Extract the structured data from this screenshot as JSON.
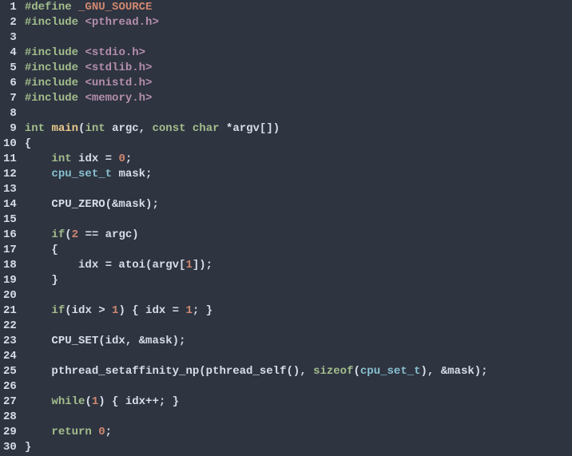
{
  "code": {
    "line_count": 30,
    "lines": [
      [
        {
          "cls": "tok-pp",
          "t": "#define "
        },
        {
          "cls": "tok-ppid",
          "t": "_GNU_SOURCE"
        }
      ],
      [
        {
          "cls": "tok-pp",
          "t": "#include "
        },
        {
          "cls": "tok-inc",
          "t": "<pthread.h>"
        }
      ],
      [],
      [
        {
          "cls": "tok-pp",
          "t": "#include "
        },
        {
          "cls": "tok-inc",
          "t": "<stdio.h>"
        }
      ],
      [
        {
          "cls": "tok-pp",
          "t": "#include "
        },
        {
          "cls": "tok-inc",
          "t": "<stdlib.h>"
        }
      ],
      [
        {
          "cls": "tok-pp",
          "t": "#include "
        },
        {
          "cls": "tok-inc",
          "t": "<unistd.h>"
        }
      ],
      [
        {
          "cls": "tok-pp",
          "t": "#include "
        },
        {
          "cls": "tok-inc",
          "t": "<memory.h>"
        }
      ],
      [],
      [
        {
          "cls": "tok-kw",
          "t": "int"
        },
        {
          "cls": "tok-ident",
          "t": " "
        },
        {
          "cls": "tok-fn",
          "t": "main"
        },
        {
          "cls": "tok-punc",
          "t": "("
        },
        {
          "cls": "tok-kw",
          "t": "int"
        },
        {
          "cls": "tok-ident",
          "t": " argc, "
        },
        {
          "cls": "tok-kw",
          "t": "const"
        },
        {
          "cls": "tok-ident",
          "t": " "
        },
        {
          "cls": "tok-kw",
          "t": "char"
        },
        {
          "cls": "tok-ident",
          "t": " *argv[])"
        }
      ],
      [
        {
          "cls": "tok-punc",
          "t": "{"
        }
      ],
      [
        {
          "cls": "tok-ident",
          "t": "    "
        },
        {
          "cls": "tok-kw",
          "t": "int"
        },
        {
          "cls": "tok-ident",
          "t": " idx = "
        },
        {
          "cls": "tok-num",
          "t": "0"
        },
        {
          "cls": "tok-punc",
          "t": ";"
        }
      ],
      [
        {
          "cls": "tok-ident",
          "t": "    "
        },
        {
          "cls": "tok-type",
          "t": "cpu_set_t"
        },
        {
          "cls": "tok-ident",
          "t": " mask;"
        }
      ],
      [],
      [
        {
          "cls": "tok-ident",
          "t": "    CPU_ZERO(&mask);"
        }
      ],
      [],
      [
        {
          "cls": "tok-ident",
          "t": "    "
        },
        {
          "cls": "tok-kw",
          "t": "if"
        },
        {
          "cls": "tok-punc",
          "t": "("
        },
        {
          "cls": "tok-num",
          "t": "2"
        },
        {
          "cls": "tok-ident",
          "t": " == argc)"
        }
      ],
      [
        {
          "cls": "tok-ident",
          "t": "    {"
        }
      ],
      [
        {
          "cls": "tok-ident",
          "t": "        idx = atoi(argv["
        },
        {
          "cls": "tok-num",
          "t": "1"
        },
        {
          "cls": "tok-ident",
          "t": "]);"
        }
      ],
      [
        {
          "cls": "tok-ident",
          "t": "    }"
        }
      ],
      [],
      [
        {
          "cls": "tok-ident",
          "t": "    "
        },
        {
          "cls": "tok-kw",
          "t": "if"
        },
        {
          "cls": "tok-ident",
          "t": "(idx > "
        },
        {
          "cls": "tok-num",
          "t": "1"
        },
        {
          "cls": "tok-ident",
          "t": ") { idx = "
        },
        {
          "cls": "tok-num",
          "t": "1"
        },
        {
          "cls": "tok-ident",
          "t": "; }"
        }
      ],
      [],
      [
        {
          "cls": "tok-ident",
          "t": "    CPU_SET(idx, &mask);"
        }
      ],
      [],
      [
        {
          "cls": "tok-ident",
          "t": "    pthread_setaffinity_np(pthread_self(), "
        },
        {
          "cls": "tok-kw",
          "t": "sizeof"
        },
        {
          "cls": "tok-ident",
          "t": "("
        },
        {
          "cls": "tok-type",
          "t": "cpu_set_t"
        },
        {
          "cls": "tok-ident",
          "t": "), &mask);"
        }
      ],
      [],
      [
        {
          "cls": "tok-ident",
          "t": "    "
        },
        {
          "cls": "tok-kw",
          "t": "while"
        },
        {
          "cls": "tok-ident",
          "t": "("
        },
        {
          "cls": "tok-num",
          "t": "1"
        },
        {
          "cls": "tok-ident",
          "t": ") { idx++; }"
        }
      ],
      [],
      [
        {
          "cls": "tok-ident",
          "t": "    "
        },
        {
          "cls": "tok-kw",
          "t": "return"
        },
        {
          "cls": "tok-ident",
          "t": " "
        },
        {
          "cls": "tok-num",
          "t": "0"
        },
        {
          "cls": "tok-punc",
          "t": ";"
        }
      ],
      [
        {
          "cls": "tok-punc",
          "t": "}"
        }
      ]
    ]
  }
}
